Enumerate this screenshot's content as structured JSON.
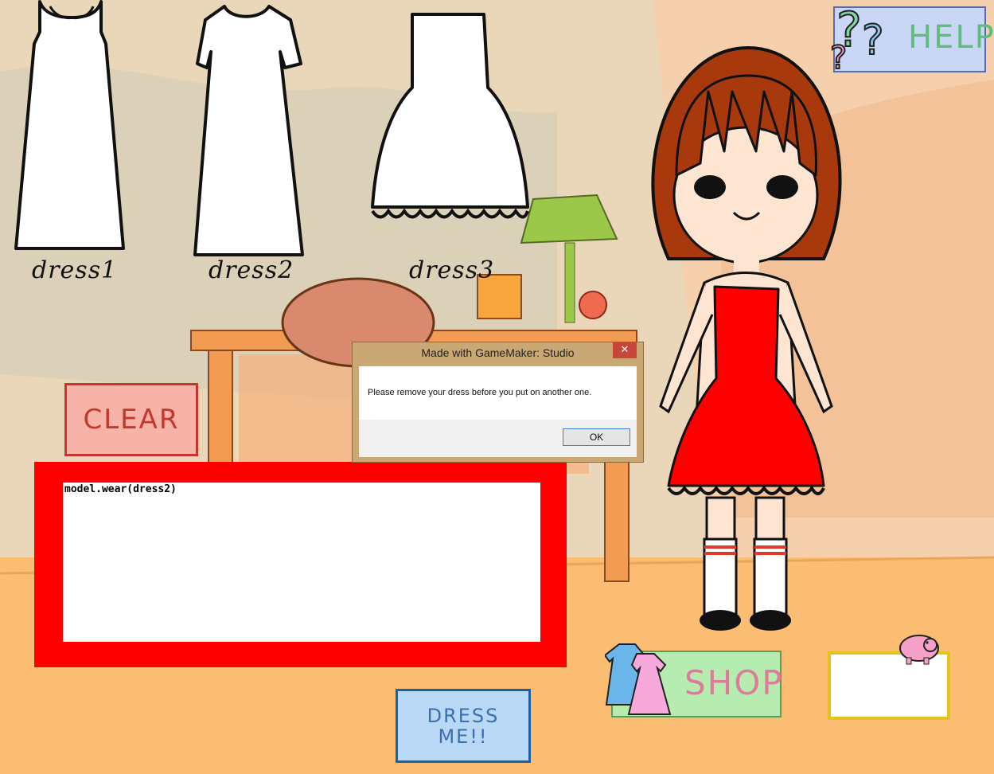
{
  "wardrobe": {
    "items": [
      {
        "label": "dress1"
      },
      {
        "label": "dress2"
      },
      {
        "label": "dress3"
      }
    ]
  },
  "buttons": {
    "clear": "CLEAR",
    "dress_me_line1": "DRESS",
    "dress_me_line2": "ME!!",
    "shop": "SHOP",
    "help": "HELP"
  },
  "code_editor": {
    "value": "model.wear(dress2)"
  },
  "dialog": {
    "title": "Made with GameMaker: Studio",
    "close": "✕",
    "message": "Please remove your dress before you put on another one.",
    "ok": "OK"
  },
  "colors": {
    "dress_worn": "#ff0000",
    "hair": "#a8390d",
    "code_frame": "#ff0000"
  }
}
